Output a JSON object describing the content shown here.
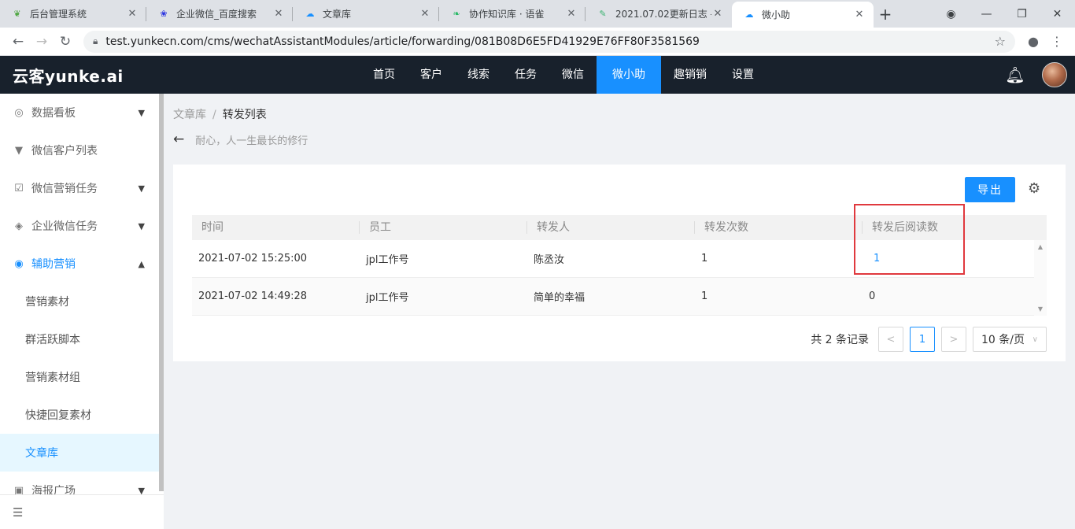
{
  "browser": {
    "tabs": [
      {
        "title": "后台管理系统",
        "icon": "leaf-icon",
        "active": false
      },
      {
        "title": "企业微信_百度搜索",
        "icon": "paw-icon",
        "active": false
      },
      {
        "title": "文章库",
        "icon": "cloud-icon",
        "active": false
      },
      {
        "title": "协作知识库 · 语雀",
        "icon": "bird-icon",
        "active": false
      },
      {
        "title": "2021.07.02更新日志 -",
        "icon": "doc-icon",
        "active": false
      },
      {
        "title": "微小助",
        "icon": "cloud-icon",
        "active": true
      }
    ],
    "url": "test.yunkecn.com/cms/wechatAssistantModules/article/forwarding/081B08D6E5FD41929E76FF80F3581569"
  },
  "app": {
    "logo": "云客yunke.ai",
    "nav": [
      "首页",
      "客户",
      "线索",
      "任务",
      "微信",
      "微小助",
      "趣销销",
      "设置"
    ],
    "active_nav": "微小助"
  },
  "sidebar": {
    "items": [
      {
        "label": "数据看板",
        "icon": "dashboard-icon",
        "has_arrow": true
      },
      {
        "label": "微信客户列表",
        "icon": "contact-icon",
        "has_arrow": false
      },
      {
        "label": "微信营销任务",
        "icon": "check-box-icon",
        "has_arrow": true
      },
      {
        "label": "企业微信任务",
        "icon": "diamond-icon",
        "has_arrow": true
      },
      {
        "label": "辅助营销",
        "icon": "target-icon",
        "has_arrow": true,
        "open": true
      }
    ],
    "subitems": [
      "营销素材",
      "群活跃脚本",
      "营销素材组",
      "快捷回复素材",
      "文章库"
    ],
    "active_sub": "文章库",
    "partial_item": "海报广场"
  },
  "breadcrumb": {
    "parent": "文章库",
    "separator": "/",
    "current": "转发列表"
  },
  "page": {
    "subtitle": "耐心，人一生最长的修行"
  },
  "toolbar": {
    "export_label": "导出"
  },
  "table": {
    "headers": [
      "时间",
      "员工",
      "转发人",
      "转发次数",
      "转发后阅读数"
    ],
    "rows": [
      [
        "2021-07-02 15:25:00",
        "jpl工作号",
        "陈丞汝",
        "1",
        "1"
      ],
      [
        "2021-07-02 14:49:28",
        "jpl工作号",
        "简单的幸福",
        "1",
        "0"
      ]
    ]
  },
  "pagination": {
    "total_text": "共 2 条记录",
    "prev": "<",
    "page": "1",
    "next": ">",
    "page_size": "10 条/页"
  },
  "colors": {
    "accent": "#1890ff",
    "header_bg": "#18212c",
    "highlight": "#e0393e"
  }
}
